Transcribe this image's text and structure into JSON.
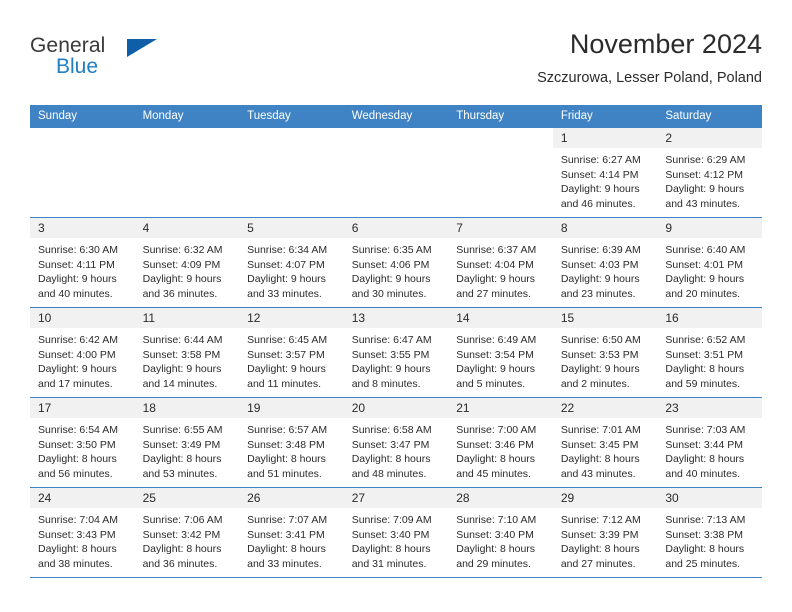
{
  "brand": {
    "word1": "General",
    "word2": "Blue",
    "triangle_color": "#0f5fa8",
    "blue_text_color": "#1f7ec4"
  },
  "header": {
    "title": "November 2024",
    "subtitle": "Szczurowa, Lesser Poland, Poland"
  },
  "theme": {
    "header_bar": "#3f83c4",
    "daynum_band": "#f1f1f1",
    "border": "#3f83c4",
    "text": "#2b2b2b"
  },
  "weekdays": [
    "Sunday",
    "Monday",
    "Tuesday",
    "Wednesday",
    "Thursday",
    "Friday",
    "Saturday"
  ],
  "weeks": [
    [
      {
        "blank": true,
        "day": "",
        "sunrise": "",
        "sunset": "",
        "daylight1": "",
        "daylight2": ""
      },
      {
        "blank": true,
        "day": "",
        "sunrise": "",
        "sunset": "",
        "daylight1": "",
        "daylight2": ""
      },
      {
        "blank": true,
        "day": "",
        "sunrise": "",
        "sunset": "",
        "daylight1": "",
        "daylight2": ""
      },
      {
        "blank": true,
        "day": "",
        "sunrise": "",
        "sunset": "",
        "daylight1": "",
        "daylight2": ""
      },
      {
        "blank": true,
        "day": "",
        "sunrise": "",
        "sunset": "",
        "daylight1": "",
        "daylight2": ""
      },
      {
        "blank": false,
        "day": "1",
        "sunrise": "Sunrise: 6:27 AM",
        "sunset": "Sunset: 4:14 PM",
        "daylight1": "Daylight: 9 hours",
        "daylight2": "and 46 minutes."
      },
      {
        "blank": false,
        "day": "2",
        "sunrise": "Sunrise: 6:29 AM",
        "sunset": "Sunset: 4:12 PM",
        "daylight1": "Daylight: 9 hours",
        "daylight2": "and 43 minutes."
      }
    ],
    [
      {
        "blank": false,
        "day": "3",
        "sunrise": "Sunrise: 6:30 AM",
        "sunset": "Sunset: 4:11 PM",
        "daylight1": "Daylight: 9 hours",
        "daylight2": "and 40 minutes."
      },
      {
        "blank": false,
        "day": "4",
        "sunrise": "Sunrise: 6:32 AM",
        "sunset": "Sunset: 4:09 PM",
        "daylight1": "Daylight: 9 hours",
        "daylight2": "and 36 minutes."
      },
      {
        "blank": false,
        "day": "5",
        "sunrise": "Sunrise: 6:34 AM",
        "sunset": "Sunset: 4:07 PM",
        "daylight1": "Daylight: 9 hours",
        "daylight2": "and 33 minutes."
      },
      {
        "blank": false,
        "day": "6",
        "sunrise": "Sunrise: 6:35 AM",
        "sunset": "Sunset: 4:06 PM",
        "daylight1": "Daylight: 9 hours",
        "daylight2": "and 30 minutes."
      },
      {
        "blank": false,
        "day": "7",
        "sunrise": "Sunrise: 6:37 AM",
        "sunset": "Sunset: 4:04 PM",
        "daylight1": "Daylight: 9 hours",
        "daylight2": "and 27 minutes."
      },
      {
        "blank": false,
        "day": "8",
        "sunrise": "Sunrise: 6:39 AM",
        "sunset": "Sunset: 4:03 PM",
        "daylight1": "Daylight: 9 hours",
        "daylight2": "and 23 minutes."
      },
      {
        "blank": false,
        "day": "9",
        "sunrise": "Sunrise: 6:40 AM",
        "sunset": "Sunset: 4:01 PM",
        "daylight1": "Daylight: 9 hours",
        "daylight2": "and 20 minutes."
      }
    ],
    [
      {
        "blank": false,
        "day": "10",
        "sunrise": "Sunrise: 6:42 AM",
        "sunset": "Sunset: 4:00 PM",
        "daylight1": "Daylight: 9 hours",
        "daylight2": "and 17 minutes."
      },
      {
        "blank": false,
        "day": "11",
        "sunrise": "Sunrise: 6:44 AM",
        "sunset": "Sunset: 3:58 PM",
        "daylight1": "Daylight: 9 hours",
        "daylight2": "and 14 minutes."
      },
      {
        "blank": false,
        "day": "12",
        "sunrise": "Sunrise: 6:45 AM",
        "sunset": "Sunset: 3:57 PM",
        "daylight1": "Daylight: 9 hours",
        "daylight2": "and 11 minutes."
      },
      {
        "blank": false,
        "day": "13",
        "sunrise": "Sunrise: 6:47 AM",
        "sunset": "Sunset: 3:55 PM",
        "daylight1": "Daylight: 9 hours",
        "daylight2": "and 8 minutes."
      },
      {
        "blank": false,
        "day": "14",
        "sunrise": "Sunrise: 6:49 AM",
        "sunset": "Sunset: 3:54 PM",
        "daylight1": "Daylight: 9 hours",
        "daylight2": "and 5 minutes."
      },
      {
        "blank": false,
        "day": "15",
        "sunrise": "Sunrise: 6:50 AM",
        "sunset": "Sunset: 3:53 PM",
        "daylight1": "Daylight: 9 hours",
        "daylight2": "and 2 minutes."
      },
      {
        "blank": false,
        "day": "16",
        "sunrise": "Sunrise: 6:52 AM",
        "sunset": "Sunset: 3:51 PM",
        "daylight1": "Daylight: 8 hours",
        "daylight2": "and 59 minutes."
      }
    ],
    [
      {
        "blank": false,
        "day": "17",
        "sunrise": "Sunrise: 6:54 AM",
        "sunset": "Sunset: 3:50 PM",
        "daylight1": "Daylight: 8 hours",
        "daylight2": "and 56 minutes."
      },
      {
        "blank": false,
        "day": "18",
        "sunrise": "Sunrise: 6:55 AM",
        "sunset": "Sunset: 3:49 PM",
        "daylight1": "Daylight: 8 hours",
        "daylight2": "and 53 minutes."
      },
      {
        "blank": false,
        "day": "19",
        "sunrise": "Sunrise: 6:57 AM",
        "sunset": "Sunset: 3:48 PM",
        "daylight1": "Daylight: 8 hours",
        "daylight2": "and 51 minutes."
      },
      {
        "blank": false,
        "day": "20",
        "sunrise": "Sunrise: 6:58 AM",
        "sunset": "Sunset: 3:47 PM",
        "daylight1": "Daylight: 8 hours",
        "daylight2": "and 48 minutes."
      },
      {
        "blank": false,
        "day": "21",
        "sunrise": "Sunrise: 7:00 AM",
        "sunset": "Sunset: 3:46 PM",
        "daylight1": "Daylight: 8 hours",
        "daylight2": "and 45 minutes."
      },
      {
        "blank": false,
        "day": "22",
        "sunrise": "Sunrise: 7:01 AM",
        "sunset": "Sunset: 3:45 PM",
        "daylight1": "Daylight: 8 hours",
        "daylight2": "and 43 minutes."
      },
      {
        "blank": false,
        "day": "23",
        "sunrise": "Sunrise: 7:03 AM",
        "sunset": "Sunset: 3:44 PM",
        "daylight1": "Daylight: 8 hours",
        "daylight2": "and 40 minutes."
      }
    ],
    [
      {
        "blank": false,
        "day": "24",
        "sunrise": "Sunrise: 7:04 AM",
        "sunset": "Sunset: 3:43 PM",
        "daylight1": "Daylight: 8 hours",
        "daylight2": "and 38 minutes."
      },
      {
        "blank": false,
        "day": "25",
        "sunrise": "Sunrise: 7:06 AM",
        "sunset": "Sunset: 3:42 PM",
        "daylight1": "Daylight: 8 hours",
        "daylight2": "and 36 minutes."
      },
      {
        "blank": false,
        "day": "26",
        "sunrise": "Sunrise: 7:07 AM",
        "sunset": "Sunset: 3:41 PM",
        "daylight1": "Daylight: 8 hours",
        "daylight2": "and 33 minutes."
      },
      {
        "blank": false,
        "day": "27",
        "sunrise": "Sunrise: 7:09 AM",
        "sunset": "Sunset: 3:40 PM",
        "daylight1": "Daylight: 8 hours",
        "daylight2": "and 31 minutes."
      },
      {
        "blank": false,
        "day": "28",
        "sunrise": "Sunrise: 7:10 AM",
        "sunset": "Sunset: 3:40 PM",
        "daylight1": "Daylight: 8 hours",
        "daylight2": "and 29 minutes."
      },
      {
        "blank": false,
        "day": "29",
        "sunrise": "Sunrise: 7:12 AM",
        "sunset": "Sunset: 3:39 PM",
        "daylight1": "Daylight: 8 hours",
        "daylight2": "and 27 minutes."
      },
      {
        "blank": false,
        "day": "30",
        "sunrise": "Sunrise: 7:13 AM",
        "sunset": "Sunset: 3:38 PM",
        "daylight1": "Daylight: 8 hours",
        "daylight2": "and 25 minutes."
      }
    ]
  ]
}
